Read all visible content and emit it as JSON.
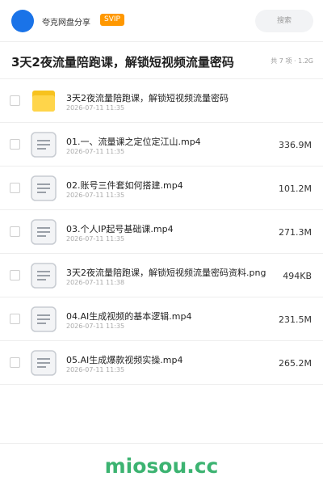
{
  "header": {
    "username": "夸克网盘分享",
    "badge": "SVIP",
    "search_label": "搜索",
    "accent_color": "#1a73e8",
    "badge_color": "#ff9800"
  },
  "share": {
    "title": "3天2夜流量陪跑课，解锁短视频流量密码",
    "meta": "共 7 项 · 1.2G"
  },
  "files": [
    {
      "name": "3天2夜流量陪跑课，解锁短视频流量密码",
      "date": "2026-07-11 11:35",
      "size": "",
      "icon": "folder-icon"
    },
    {
      "name": "01.一、流量课之定位定江山.mp4",
      "date": "2026-07-11 11:35",
      "size": "336.9M",
      "icon": "file-icon"
    },
    {
      "name": "02.账号三件套如何搭建.mp4",
      "date": "2026-07-11 11:35",
      "size": "101.2M",
      "icon": "file-icon"
    },
    {
      "name": "03.个人IP起号基础课.mp4",
      "date": "2026-07-11 11:35",
      "size": "271.3M",
      "icon": "file-icon"
    },
    {
      "name": "3天2夜流量陪跑课，解锁短视频流量密码资料.png",
      "date": "2026-07-11 11:38",
      "size": "494KB",
      "icon": "file-icon"
    },
    {
      "name": "04.AI生成视频的基本逻辑.mp4",
      "date": "2026-07-11 11:35",
      "size": "231.5M",
      "icon": "file-icon"
    },
    {
      "name": "05.AI生成爆款视频实操.mp4",
      "date": "2026-07-11 11:35",
      "size": "265.2M",
      "icon": "file-icon"
    }
  ],
  "watermark": {
    "text": "miosou.cc",
    "color": "#3cb371"
  }
}
